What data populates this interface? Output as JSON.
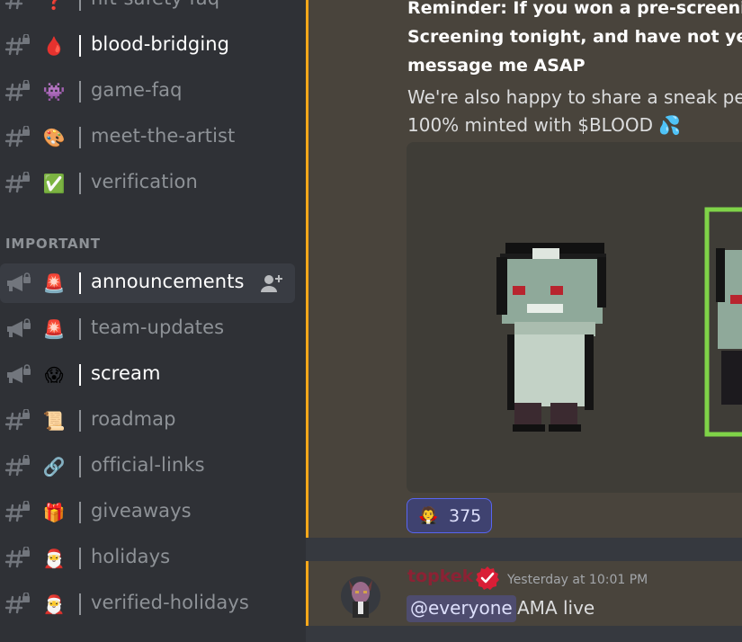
{
  "sidebar": {
    "section_header": "IMPORTANT",
    "channels": [
      {
        "label": "nft-safety-faq",
        "emoji": "❓",
        "type": "text-locked",
        "bright": false
      },
      {
        "label": "blood-bridging",
        "emoji": "🩸",
        "type": "text-locked",
        "bright": true
      },
      {
        "label": "game-faq",
        "emoji": "👾",
        "type": "text-locked",
        "bright": false
      },
      {
        "label": "meet-the-artist",
        "emoji": "🎨",
        "type": "text-locked",
        "bright": false
      },
      {
        "label": "verification",
        "emoji": "✅",
        "type": "text-locked",
        "bright": false
      },
      {
        "label": "announcements",
        "emoji": "🚨",
        "type": "announce-locked",
        "bright": true,
        "active": true
      },
      {
        "label": "team-updates",
        "emoji": "🚨",
        "type": "announce-locked",
        "bright": false
      },
      {
        "label": "scream",
        "emoji": "😱",
        "type": "announce-locked",
        "bright": true
      },
      {
        "label": "roadmap",
        "emoji": "📜",
        "type": "text-locked",
        "bright": false
      },
      {
        "label": "official-links",
        "emoji": "🔗",
        "type": "text-locked",
        "bright": false
      },
      {
        "label": "giveaways",
        "emoji": "🎁",
        "type": "text-locked",
        "bright": false
      },
      {
        "label": "holidays",
        "emoji": "🎅",
        "type": "text-locked",
        "bright": false
      },
      {
        "label": "verified-holidays",
        "emoji": "🎅",
        "type": "text-locked",
        "bright": false
      }
    ]
  },
  "chat": {
    "message1": {
      "line1": "Reminder: If you won a pre-screening",
      "line2": "Screening tonight, and have not yet s",
      "line3": "message me ASAP",
      "line4": "We're also happy to share a sneak pea",
      "line5": "100% minted with $BLOOD 💦",
      "reaction_emoji": "🧛",
      "reaction_count": "375"
    },
    "message2": {
      "username": "topkek",
      "timestamp": "Yesterday at 10:01 PM",
      "mention": "@everyone",
      "text": "AMA live"
    }
  },
  "colors": {
    "sidebar_bg": "#2f3136",
    "chat_bg": "#36393f",
    "mention_highlight": "#49443c",
    "mention_border": "#faa81a",
    "reaction_border": "#5865f2",
    "verified_red": "#d91e36"
  }
}
